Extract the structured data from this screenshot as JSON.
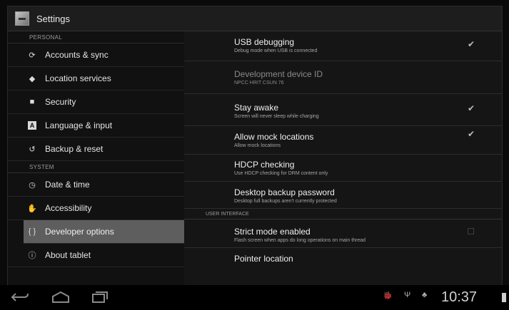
{
  "topbar": {
    "title": "Settings",
    "icon": "settings-app-icon"
  },
  "sidebar": {
    "sections": [
      {
        "header": "PERSONAL",
        "items": [
          {
            "label": "Accounts & sync",
            "icon": "sync-icon"
          },
          {
            "label": "Location services",
            "icon": "location-icon"
          },
          {
            "label": "Security",
            "icon": "lock-icon"
          },
          {
            "label": "Language & input",
            "icon": "keyboard-icon"
          },
          {
            "label": "Backup & reset",
            "icon": "restore-icon"
          }
        ]
      },
      {
        "header": "SYSTEM",
        "items": [
          {
            "label": "Date & time",
            "icon": "clock-icon"
          },
          {
            "label": "Accessibility",
            "icon": "hand-icon"
          },
          {
            "label": "Developer options",
            "icon": "braces-icon",
            "selected": true
          },
          {
            "label": "About tablet",
            "icon": "info-icon"
          }
        ]
      }
    ]
  },
  "developer": {
    "usb_debugging": {
      "title": "USB debugging",
      "summary": "Debug mode when USB is connected",
      "checked": true
    },
    "device_id": {
      "title": "Development device ID",
      "summary": "NPCC HRIT CSUN 76"
    },
    "stay_awake": {
      "title": "Stay awake",
      "summary": "Screen will never sleep while charging",
      "checked": true
    },
    "mock_locations": {
      "title": "Allow mock locations",
      "summary": "Allow mock locations",
      "checked": true
    },
    "hdcp": {
      "title": "HDCP checking",
      "summary": "Use HDCP checking for DRM content only"
    },
    "backup_password": {
      "title": "Desktop backup password",
      "summary": "Desktop full backups aren't currently protected"
    },
    "ui_header": "USER INTERFACE",
    "strict_mode": {
      "title": "Strict mode enabled",
      "summary": "Flash screen when apps do long operations on main thread",
      "checked": false
    },
    "pointer_location": {
      "title": "Pointer location"
    }
  },
  "navbar": {
    "back": "back-icon",
    "home": "home-icon",
    "recents": "recent-apps-icon"
  },
  "status": {
    "time": "10:37"
  }
}
